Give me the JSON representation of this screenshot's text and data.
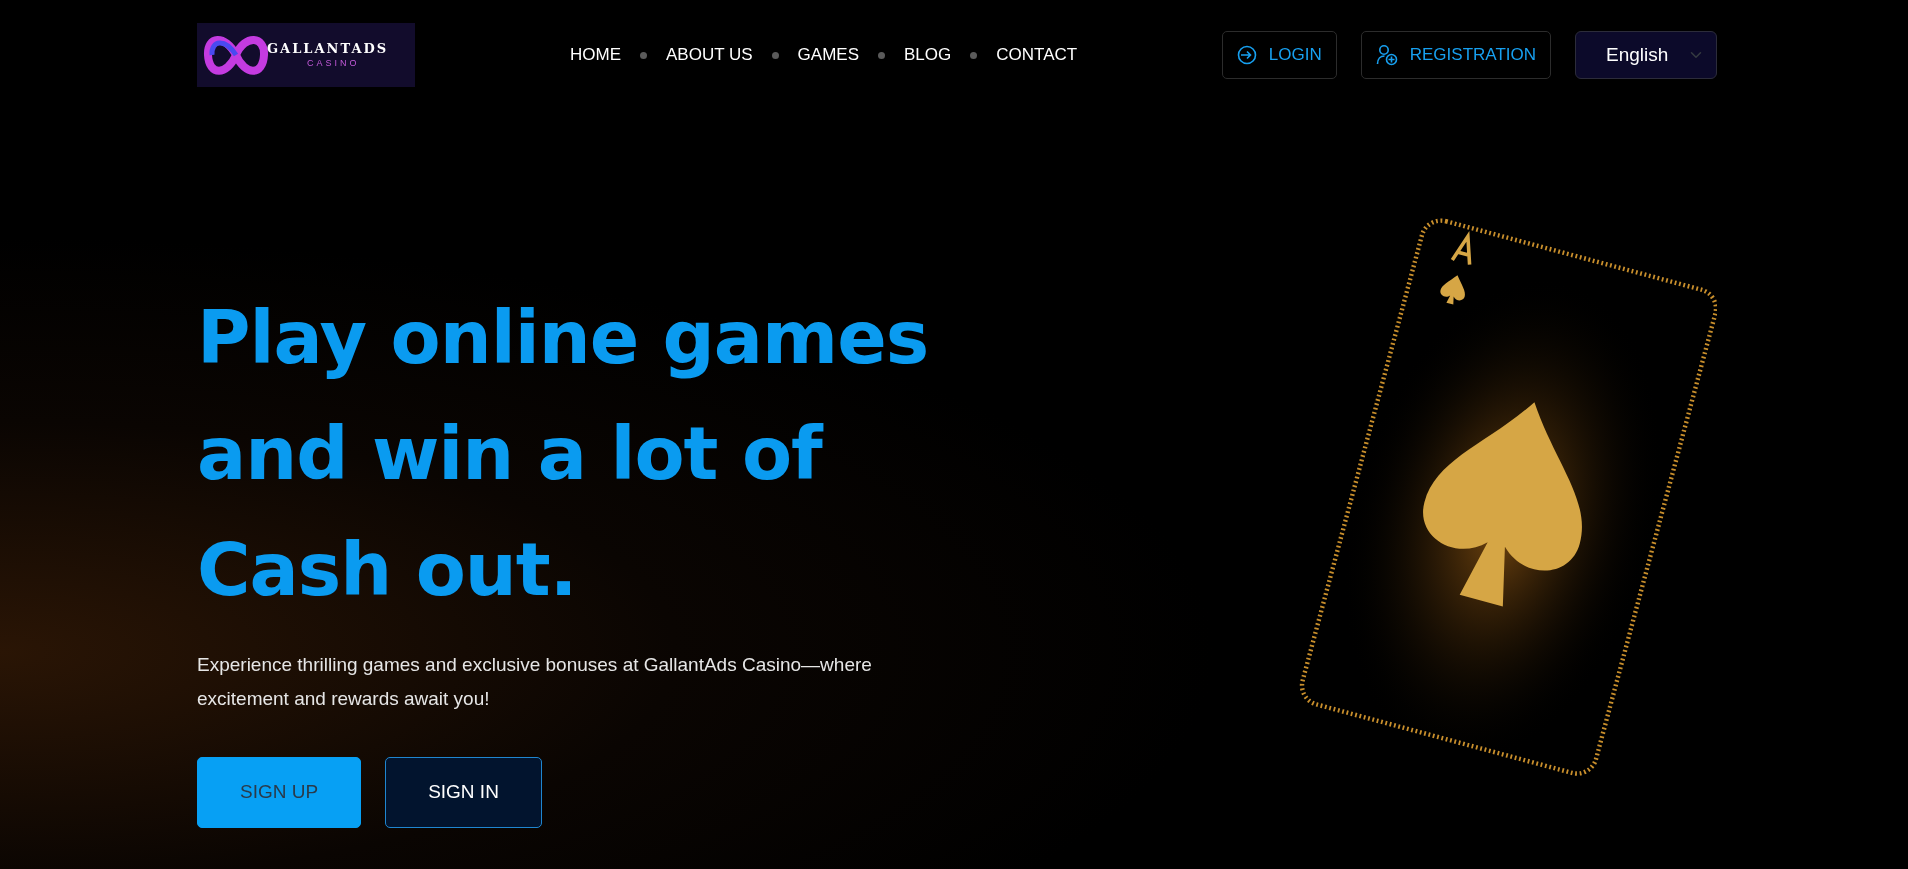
{
  "logo": {
    "title": "GALLANTADS",
    "subtitle": "CASINO"
  },
  "nav": {
    "links": [
      {
        "label": "HOME"
      },
      {
        "label": "ABOUT US"
      },
      {
        "label": "GAMES"
      },
      {
        "label": "BLOG"
      },
      {
        "label": "CONTACT"
      }
    ]
  },
  "header_buttons": [
    {
      "label": "LOGIN",
      "kind": "login"
    },
    {
      "label": "REGISTRATION",
      "kind": "register"
    }
  ],
  "language_select": {
    "value": "English"
  },
  "hero": {
    "headline_lines": [
      "Play online games",
      "and win a lot of",
      "Cash out."
    ],
    "description": "Experience thrilling games and exclusive bonuses at GallantAds Casino—where excitement and rewards await you!",
    "buttons": [
      {
        "label": "SIGN UP",
        "kind": "primary"
      },
      {
        "label": "SIGN IN",
        "kind": "outline"
      }
    ]
  }
}
